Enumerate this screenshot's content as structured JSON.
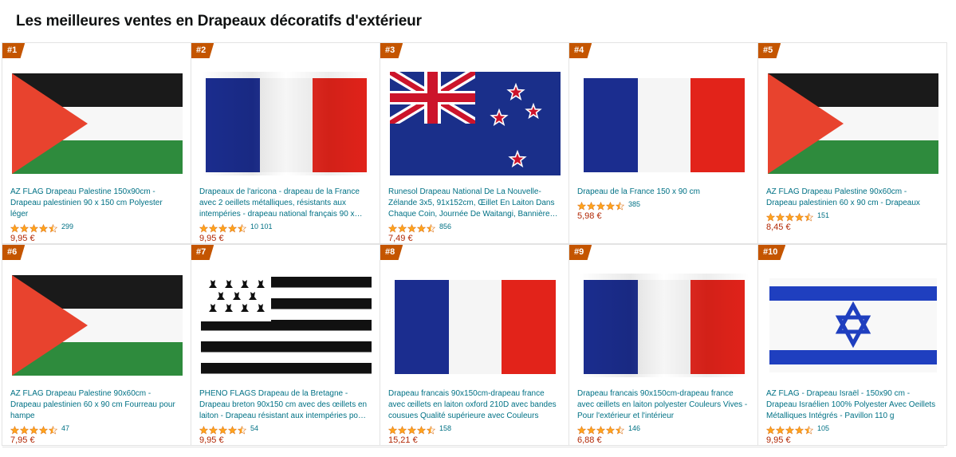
{
  "page": {
    "title": "Les meilleures ventes en Drapeaux décoratifs d'extérieur"
  },
  "colors": {
    "rank_badge": "#c45500",
    "link": "#007185",
    "price": "#B12704",
    "star": "#FFA41C"
  },
  "products": [
    {
      "rank": "#1",
      "flag": "palestine",
      "title": "AZ FLAG Drapeau Palestine 150x90cm - Drapeau palestinien 90 x 150 cm Polyester léger",
      "rating": 4.5,
      "reviews": "299",
      "price": "9,95 €"
    },
    {
      "rank": "#2",
      "flag": "france-wrinkled",
      "title": "Drapeaux de l'aricona - drapeau de la France avec 2 oeillets métalliques, résistants aux intempéries - drapeau national français 90 x…",
      "rating": 4.5,
      "reviews": "10 101",
      "price": "9,95 €"
    },
    {
      "rank": "#3",
      "flag": "new-zealand",
      "title": "Runesol Drapeau National De La Nouvelle-Zélande 3x5, 91x152cm, Œillet En Laiton Dans Chaque Coin, Journée De Waitangi, Bannière…",
      "rating": 4.5,
      "reviews": "856",
      "price": "7,49 €"
    },
    {
      "rank": "#4",
      "flag": "france",
      "title": "Drapeau de la France 150 x 90 cm",
      "rating": 4.5,
      "reviews": "385",
      "price": "5,98 €"
    },
    {
      "rank": "#5",
      "flag": "palestine",
      "title": "AZ FLAG Drapeau Palestine 90x60cm - Drapeau palestinien 60 x 90 cm - Drapeaux",
      "rating": 4.5,
      "reviews": "151",
      "price": "8,45 €"
    },
    {
      "rank": "#6",
      "flag": "palestine",
      "title": "AZ FLAG Drapeau Palestine 90x60cm - Drapeau palestinien 60 x 90 cm Fourreau pour hampe",
      "rating": 4.5,
      "reviews": "47",
      "price": "7,95 €"
    },
    {
      "rank": "#7",
      "flag": "brittany",
      "title": "PHENO FLAGS Drapeau de la Bretagne - Drapeau breton 90x150 cm avec des œillets en laiton - Drapeau résistant aux intempéries po…",
      "rating": 4.5,
      "reviews": "54",
      "price": "9,95 €"
    },
    {
      "rank": "#8",
      "flag": "france",
      "title": "Drapeau francais 90x150cm-drapeau france avec œillets en laiton oxford 210D avec bandes cousues Qualité supérieure avec Couleurs Viv…",
      "rating": 4.5,
      "reviews": "158",
      "price": "15,21 €"
    },
    {
      "rank": "#9",
      "flag": "france-wrinkled",
      "title": "Drapeau francais 90x150cm-drapeau france avec œillets en laiton polyester Couleurs Vives -Pour l'extérieur et l'intérieur",
      "rating": 4.5,
      "reviews": "146",
      "price": "6,88 €"
    },
    {
      "rank": "#10",
      "flag": "israel",
      "title": "AZ FLAG - Drapeau Israël - 150x90 cm - Drapeau Israélien 100% Polyester Avec Oeillets Métalliques Intégrés - Pavillon 110 g",
      "rating": 4.5,
      "reviews": "105",
      "price": "9,95 €"
    }
  ]
}
